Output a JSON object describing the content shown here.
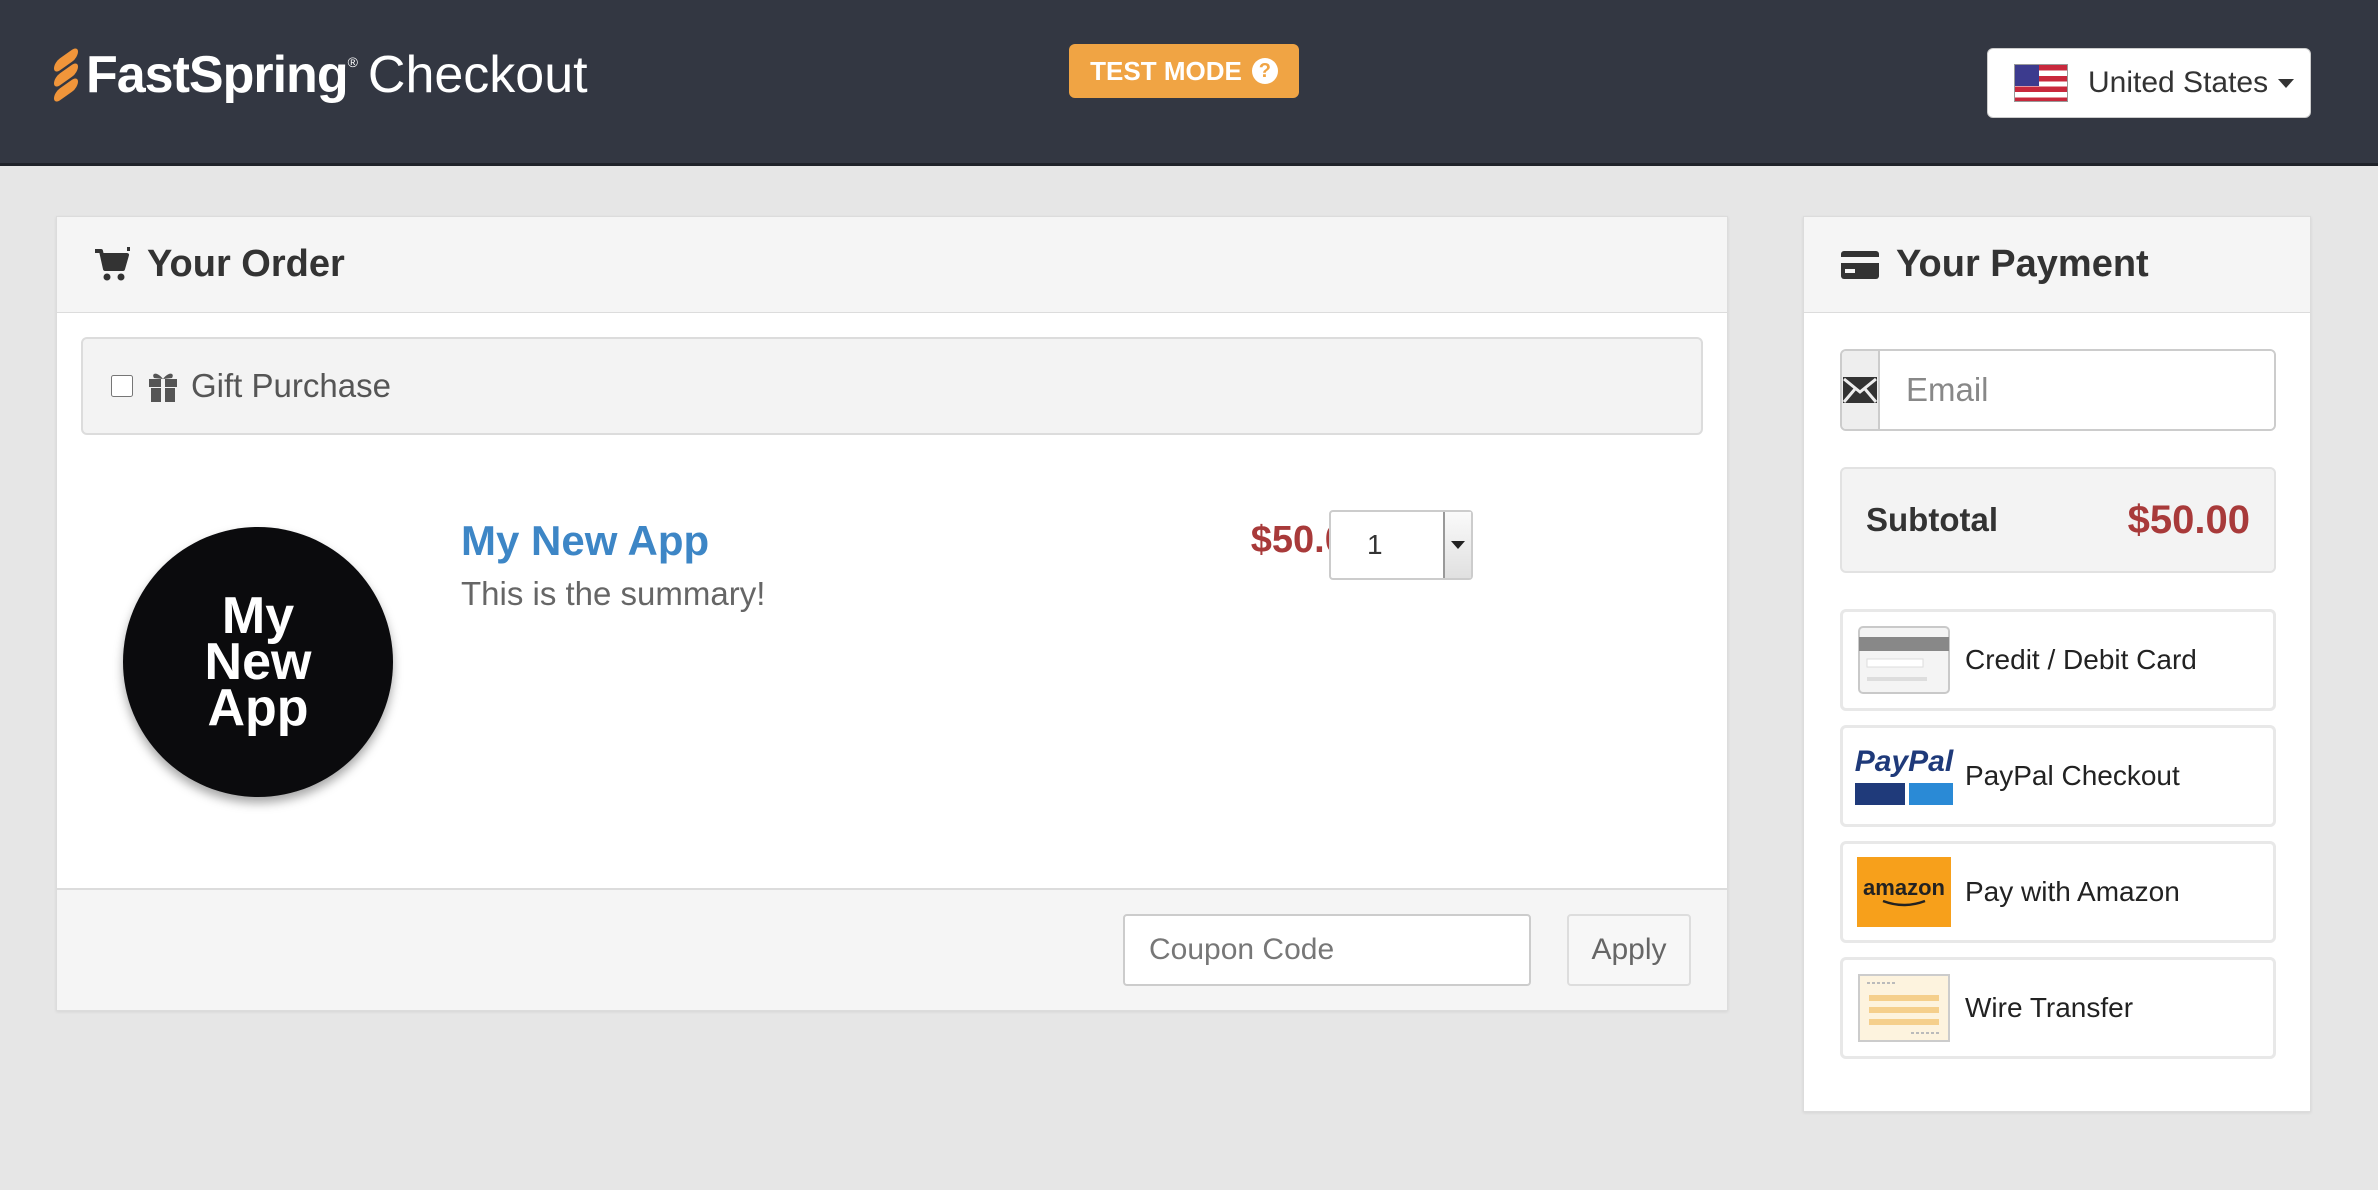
{
  "header": {
    "brand": "FastSpring",
    "brand_tm": "®",
    "product": "Checkout",
    "test_mode": "TEST MODE",
    "test_mode_help": "?",
    "country": "United States",
    "brand_accent": "#f0953a",
    "bar_color": "#333742"
  },
  "order": {
    "title": "Your Order",
    "gift_label": "Gift Purchase",
    "gift_checked": false,
    "product": {
      "image_text": [
        "My",
        "New",
        "App"
      ],
      "name": "My New App",
      "summary": "This is the summary!",
      "price": "$50.00",
      "quantity": "1"
    },
    "coupon_placeholder": "Coupon Code",
    "apply_label": "Apply"
  },
  "payment": {
    "title": "Your Payment",
    "email_placeholder": "Email",
    "subtotal_label": "Subtotal",
    "subtotal_value": "$50.00",
    "methods": [
      {
        "label": "Credit / Debit Card",
        "icon": "credit-card-icon"
      },
      {
        "label": "PayPal Checkout",
        "icon": "paypal-logo"
      },
      {
        "label": "Pay with Amazon",
        "icon": "amazon-logo"
      },
      {
        "label": "Wire Transfer",
        "icon": "wire-transfer-icon"
      }
    ],
    "paypal_logo_text": "PayPal",
    "amazon_logo_text": "amazon"
  },
  "colors": {
    "price_red": "#a83a3a",
    "link_blue": "#3d86c6",
    "test_mode_orange": "#f0a444"
  }
}
